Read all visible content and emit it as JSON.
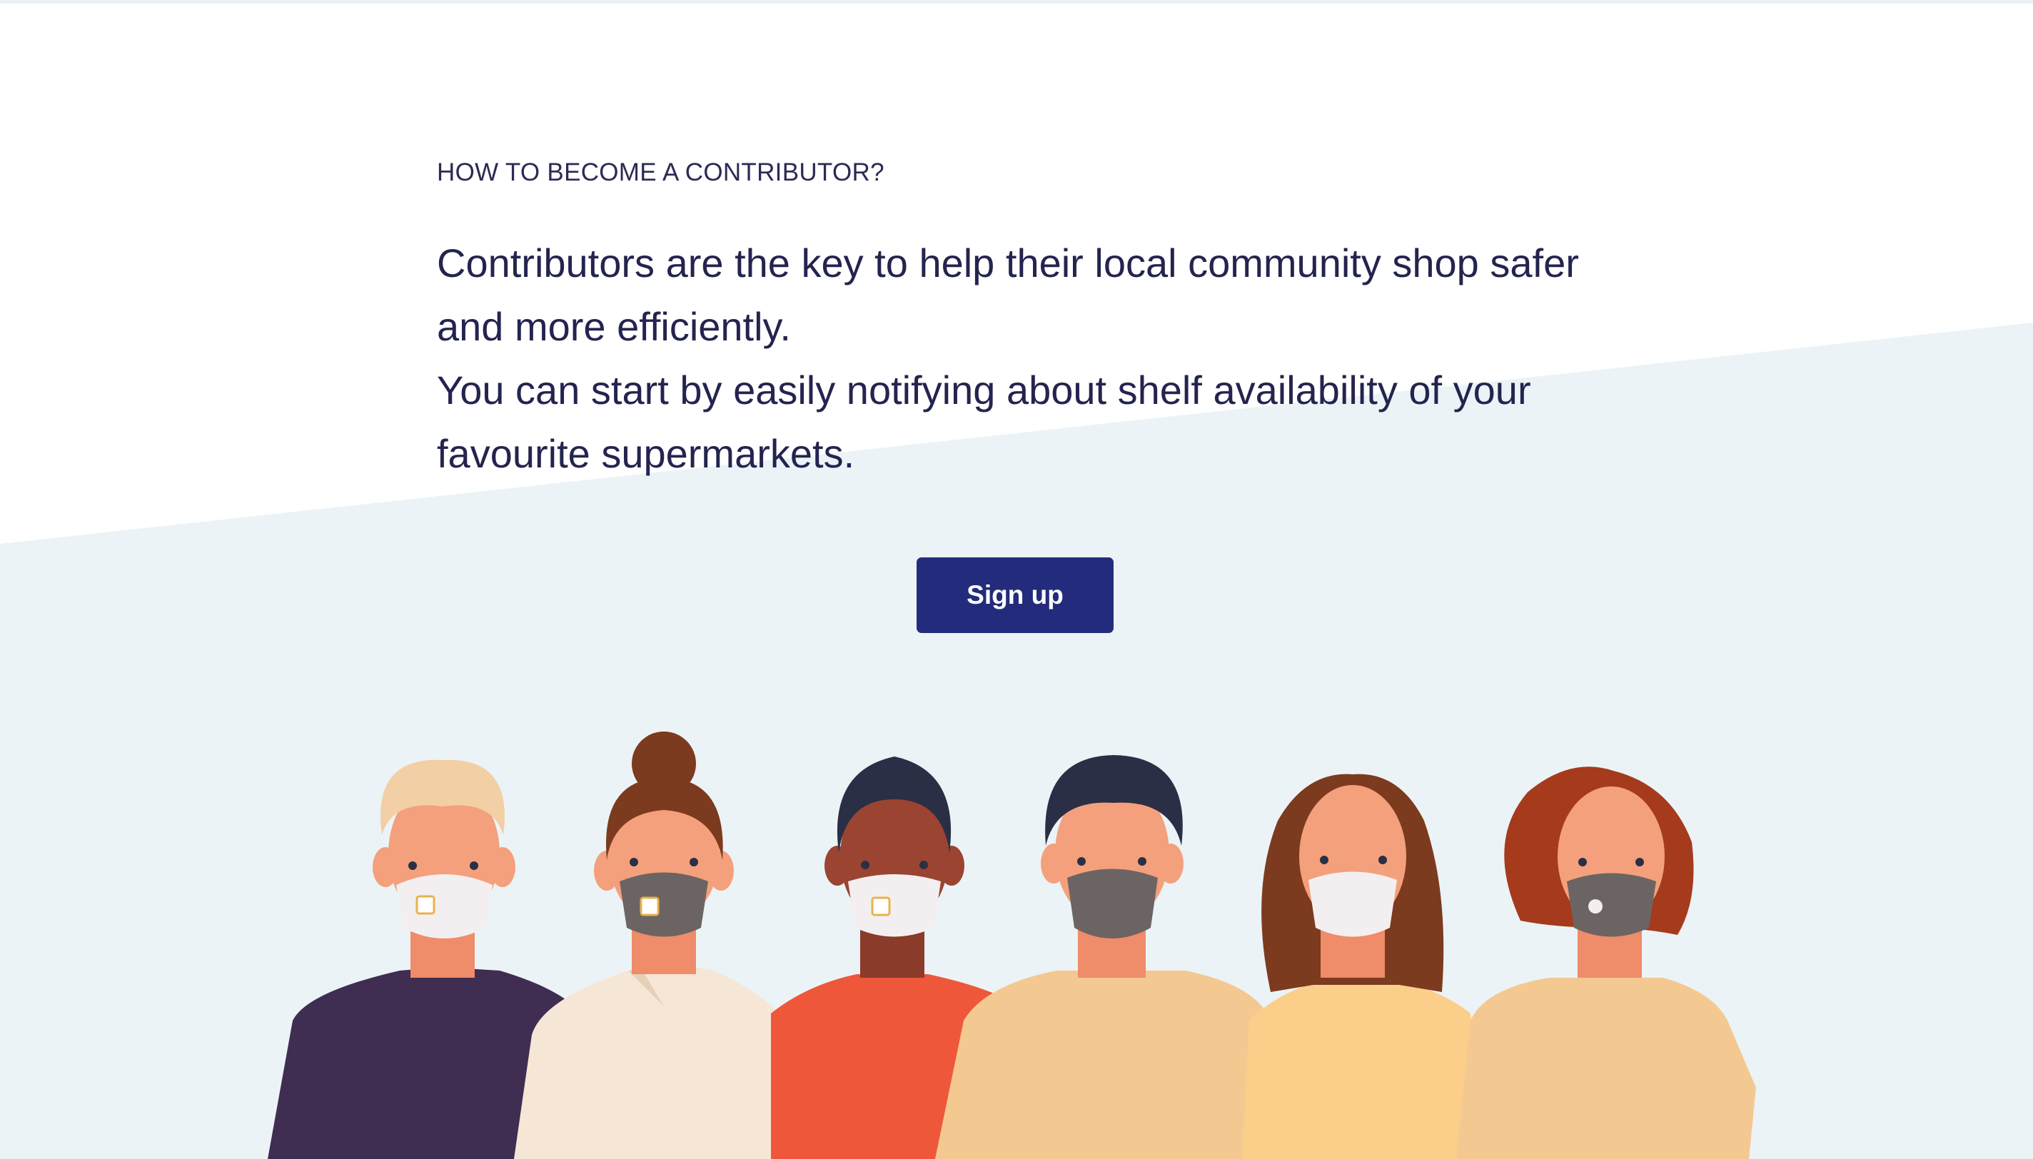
{
  "section": {
    "eyebrow": "HOW TO BECOME A CONTRIBUTOR?",
    "lead_lines": [
      "Contributors are the key to help their local community shop safer",
      "and more efficiently.",
      "You can start by easily notifying about shelf availability of your",
      "favourite supermarkets."
    ]
  },
  "cta": {
    "label": "Sign up"
  },
  "colors": {
    "text": "#23244f",
    "button": "#232c7c",
    "band": "#ebf3f6"
  },
  "illustration": {
    "people": [
      {
        "shirt": "#3f2d52",
        "hair": "#f2cfa4",
        "mask": "white-valve"
      },
      {
        "shirt": "#f6e6d6",
        "hair": "#7c3a1e",
        "mask": "grey-valve"
      },
      {
        "shirt": "#ef573b",
        "hair": "#2a2f45",
        "mask": "white-valve"
      },
      {
        "shirt": "#f3c991",
        "hair": "#2a2f45",
        "mask": "grey"
      },
      {
        "shirt": "#fbcf8a",
        "hair": "#7c3a1e",
        "mask": "white"
      },
      {
        "shirt": "#f3c991",
        "hair": "#a63a1c",
        "mask": "grey-round-valve"
      }
    ]
  }
}
